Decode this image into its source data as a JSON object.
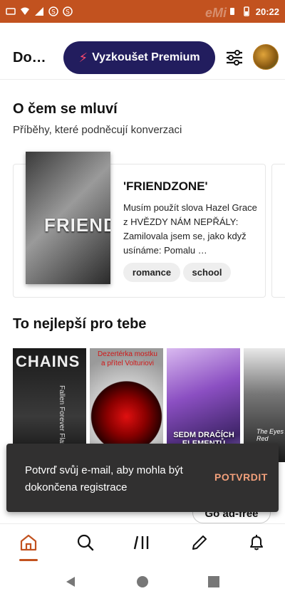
{
  "status_bar": {
    "time": "20:22",
    "watermark": "eMi"
  },
  "header": {
    "title": "Do…",
    "premium_label": "Vyzkoušet Premium"
  },
  "talk_section": {
    "title": "O čem se mluví",
    "subtitle": "Příběhy, které podněcují konverzaci",
    "story": {
      "cover_text": "FRIENDS",
      "title": "'FRIENDZONE'",
      "description": "Musím použít slova Hazel Grace z HVĚZDY NÁM NEPŘÁLY: Zamilovala jsem se, jako když usínáme: Pomalu …",
      "tags": [
        "romance",
        "school"
      ]
    }
  },
  "best_section": {
    "title": "To nejlepší pro tebe",
    "covers": [
      {
        "text": "CHAINS",
        "side_text": "Fallen Forever Flame"
      },
      {
        "text": "Dezertérka mostku a přítel Volturiovi"
      },
      {
        "text": "SEDM DRAČÍCH ELEMENTŮ"
      },
      {
        "text": "The Eyes Are Red"
      }
    ]
  },
  "snackbar": {
    "message": "Potvrď svůj e-mail, aby mohla být dokončena registrace",
    "action": "POTVRDIT"
  },
  "behind": {
    "pill_label": "Go ad-free"
  },
  "tabs": [
    {
      "name": "home",
      "icon": "home-icon"
    },
    {
      "name": "search",
      "icon": "search-icon"
    },
    {
      "name": "library",
      "icon": "library-icon"
    },
    {
      "name": "write",
      "icon": "pencil-icon"
    },
    {
      "name": "notifications",
      "icon": "bell-icon"
    }
  ],
  "colors": {
    "accent": "#c2521f",
    "premium_bg": "#221d5e",
    "snackbar_bg": "#313030",
    "snackbar_action": "#f2a07b"
  }
}
